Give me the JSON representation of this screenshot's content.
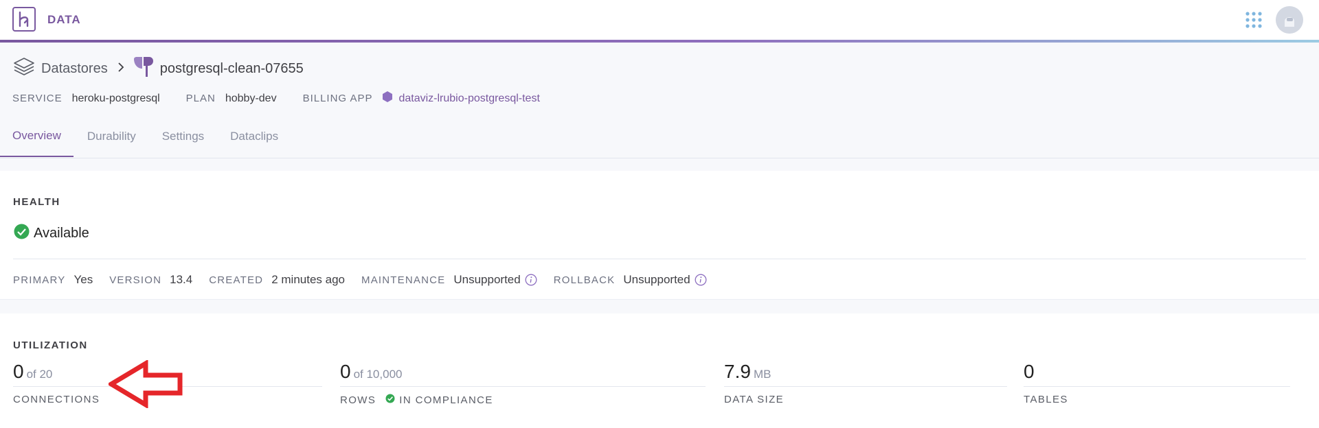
{
  "topbar": {
    "brand": "DATA",
    "logo_icon": "heroku-logo-icon",
    "apps_icon": "apps-grid-icon",
    "avatar_icon": "user-avatar-icon"
  },
  "header": {
    "breadcrumb": {
      "datastores": "Datastores",
      "database": "postgresql-clean-07655"
    },
    "meta": {
      "service_label": "SERVICE",
      "service_value": "heroku-postgresql",
      "plan_label": "PLAN",
      "plan_value": "hobby-dev",
      "billing_label": "BILLING APP",
      "billing_value": "dataviz-lrubio-postgresql-test"
    },
    "tabs": [
      {
        "label": "Overview",
        "active": true
      },
      {
        "label": "Durability",
        "active": false
      },
      {
        "label": "Settings",
        "active": false
      },
      {
        "label": "Dataclips",
        "active": false
      }
    ]
  },
  "health": {
    "title": "HEALTH",
    "status": "Available",
    "stats": {
      "primary_label": "PRIMARY",
      "primary_value": "Yes",
      "version_label": "VERSION",
      "version_value": "13.4",
      "created_label": "CREATED",
      "created_value": "2 minutes ago",
      "maintenance_label": "MAINTENANCE",
      "maintenance_value": "Unsupported",
      "rollback_label": "ROLLBACK",
      "rollback_value": "Unsupported"
    }
  },
  "utilization": {
    "title": "UTILIZATION",
    "connections": {
      "value": "0",
      "sub": "of 20",
      "label": "CONNECTIONS"
    },
    "rows": {
      "value": "0",
      "sub": "of 10,000",
      "label": "ROWS",
      "compliance": "IN COMPLIANCE"
    },
    "data_size": {
      "value": "7.9",
      "sub": "MB",
      "label": "DATA SIZE"
    },
    "tables": {
      "value": "0",
      "label": "TABLES"
    }
  },
  "colors": {
    "accent": "#79589f",
    "success": "#34a853",
    "annotation_arrow": "#e5262a"
  }
}
